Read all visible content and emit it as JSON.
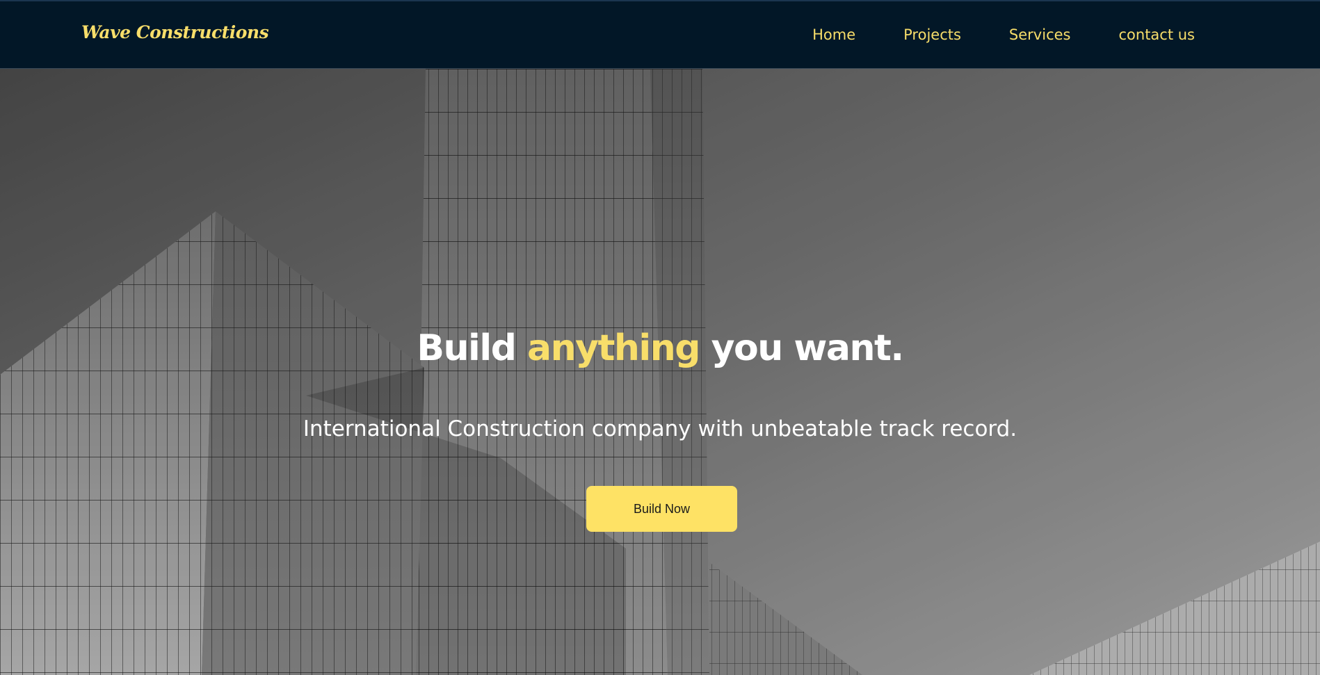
{
  "brand": {
    "logo_text": "Wave Constructions",
    "accent_color": "#f8de6a",
    "nav_bg_color": "#021727"
  },
  "nav": {
    "items": [
      {
        "label": "Home"
      },
      {
        "label": "Projects"
      },
      {
        "label": "Services"
      },
      {
        "label": "contact us"
      }
    ]
  },
  "hero": {
    "headline_start": "Build",
    "headline_accent": "anything",
    "headline_end": "you want.",
    "subheadline": "International Construction company with unbeatable track record.",
    "cta_label": "Build Now",
    "cta_color": "#fee265",
    "background_image": "black-and-white-skyscraper-grid-facade"
  }
}
